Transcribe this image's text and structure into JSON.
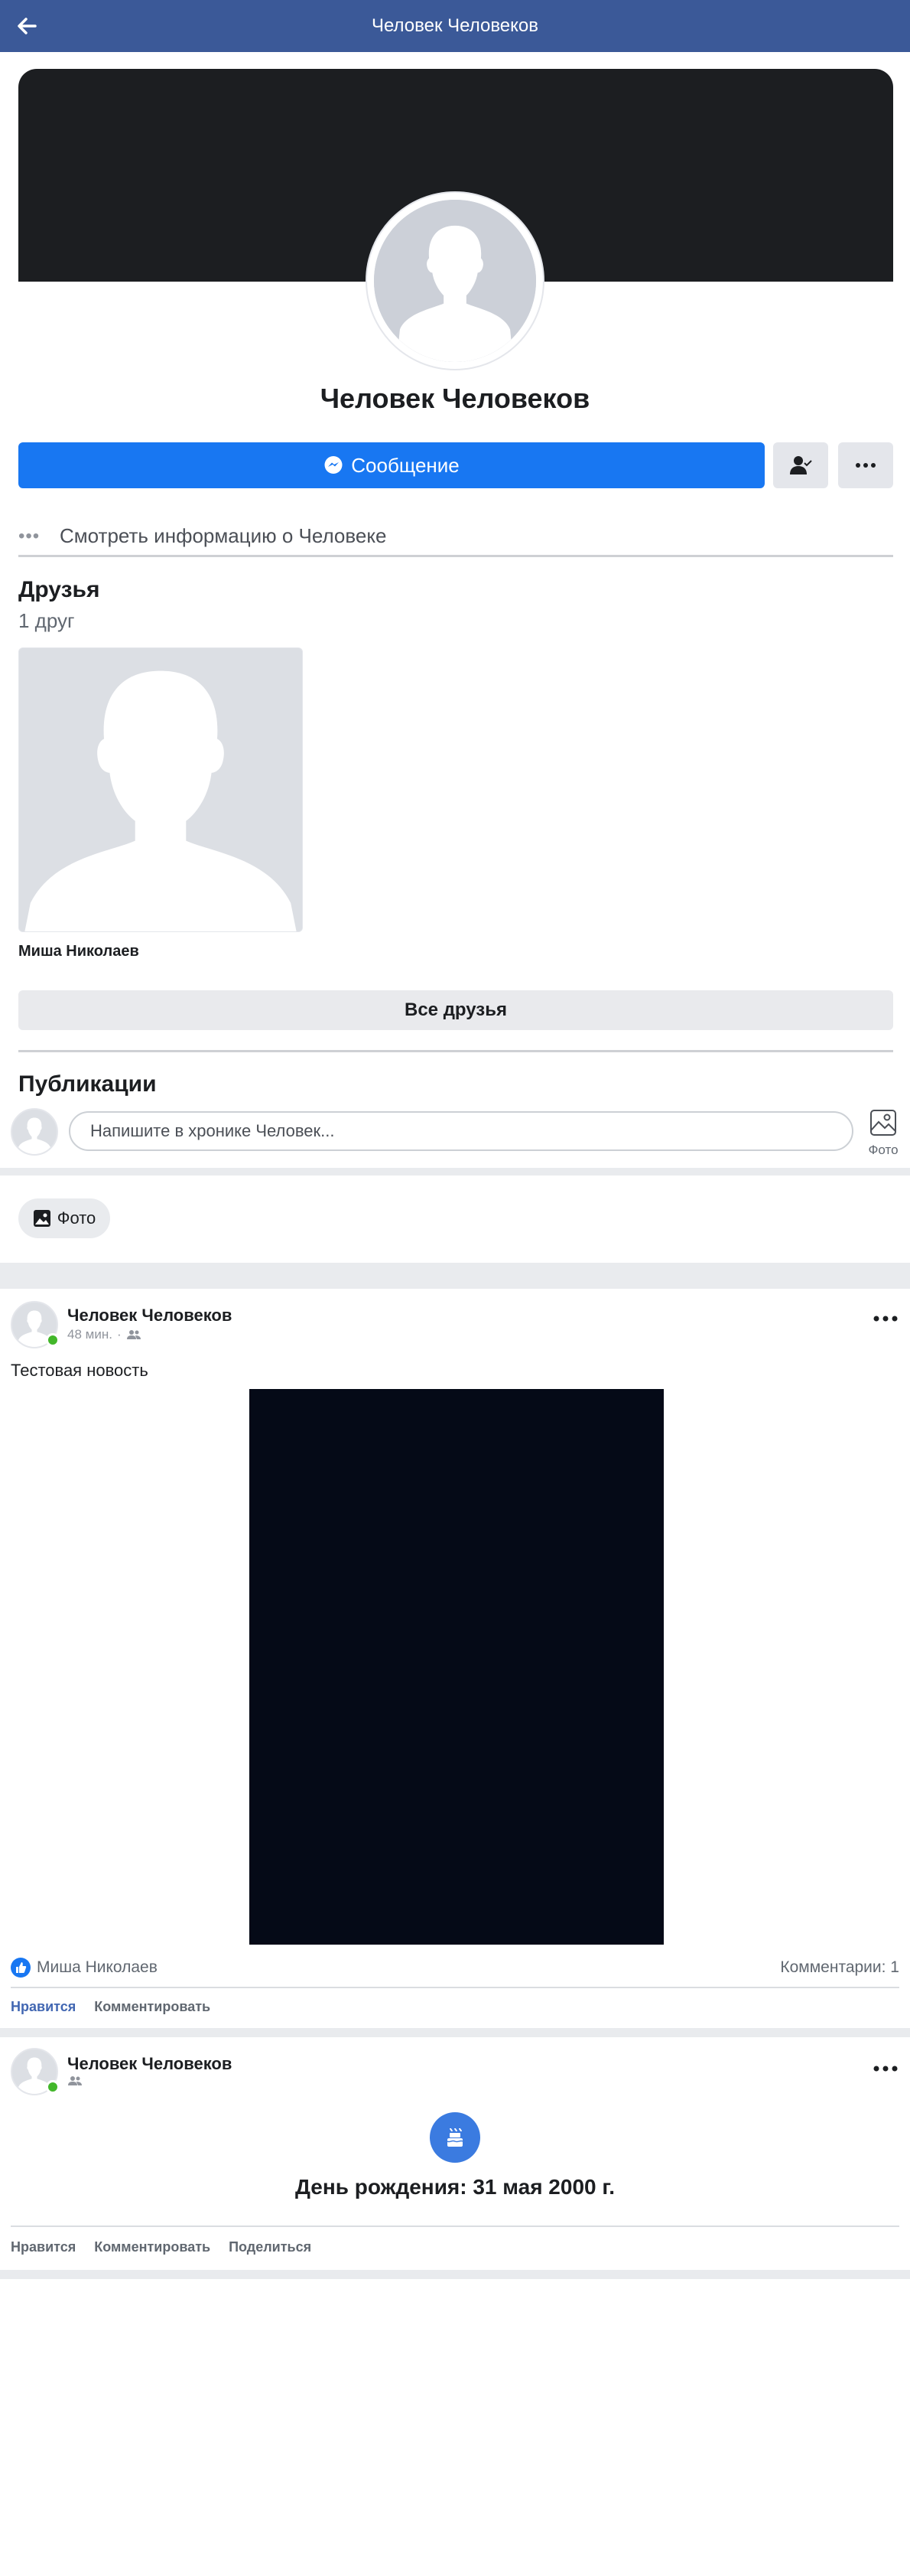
{
  "header": {
    "title": "Человек Человеков"
  },
  "profile": {
    "name": "Человек Человеков",
    "message_button": "Сообщение",
    "info_link": "Смотреть информацию о Человеке"
  },
  "friends": {
    "title": "Друзья",
    "count_text": "1 друг",
    "items": [
      {
        "name": "Миша Николаев"
      }
    ],
    "all_button": "Все друзья"
  },
  "publications": {
    "title": "Публикации",
    "composer_placeholder": "Напишите в хронике Человек...",
    "composer_photo_label": "Фото",
    "photo_chip": "Фото"
  },
  "posts": [
    {
      "author": "Человек Человеков",
      "time": "48 мин.",
      "text": "Тестовая новость",
      "liked_by": "Миша Николаев",
      "comments": "Комментарии: 1",
      "actions": [
        "Нравится",
        "Комментировать"
      ]
    },
    {
      "author": "Человек Человеков",
      "event": "День рождения: 31 мая 2000 г.",
      "actions": [
        "Нравится",
        "Комментировать",
        "Поделиться"
      ]
    }
  ],
  "colors": {
    "header": "#3b5998",
    "primary": "#1877f2",
    "online": "#42b72a",
    "cover": "#1c1e21",
    "liked_action": "#4267b2"
  },
  "icons": {
    "back": "arrow-left-icon",
    "messenger": "messenger-icon",
    "friend_status": "friend-check-icon",
    "more": "more-dots-icon",
    "photo": "photo-icon",
    "like": "thumb-up-icon",
    "audience": "friends-audience-icon",
    "birthday": "birthday-cake-icon"
  }
}
